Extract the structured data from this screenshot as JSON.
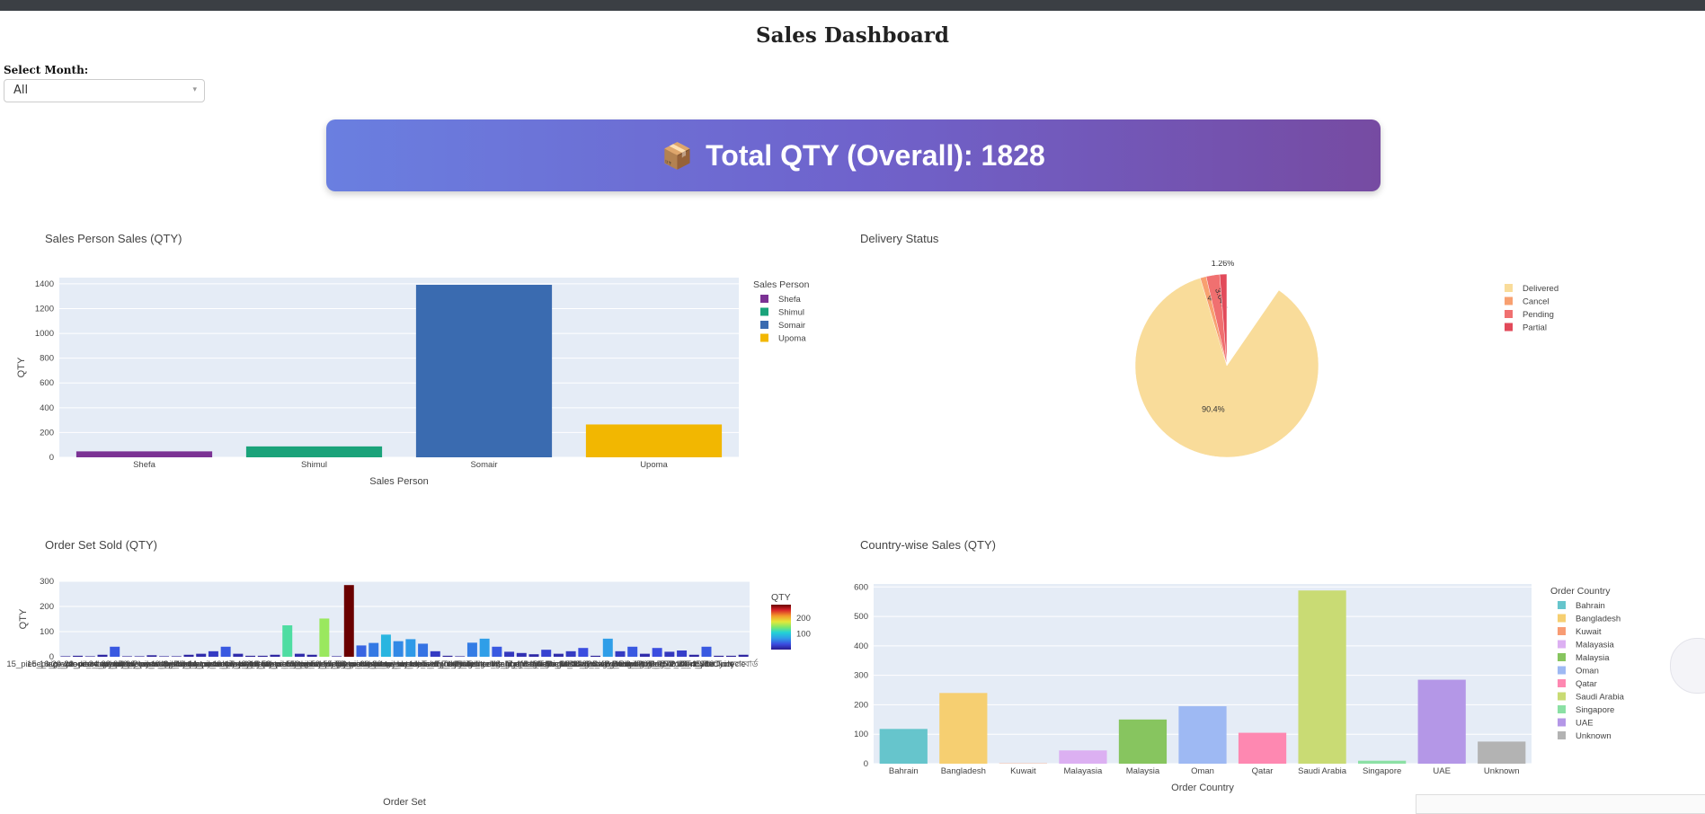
{
  "page": {
    "title": "Sales Dashboard"
  },
  "filter": {
    "label": "Select Month:",
    "selected": "All"
  },
  "kpi": {
    "icon": "package-icon",
    "text": "Total QTY (Overall): 1828"
  },
  "chart_data": [
    {
      "id": "sales_person",
      "type": "bar",
      "title": "Sales Person Sales (QTY)",
      "xlabel": "Sales Person",
      "ylabel": "QTY",
      "legend_title": "Sales Person",
      "legend_position": "right",
      "ylim": [
        0,
        1450
      ],
      "yticks": [
        0,
        200,
        400,
        600,
        800,
        1000,
        1200,
        1400
      ],
      "grid": true,
      "categories": [
        "Shefa",
        "Shimul",
        "Somair",
        "Upoma"
      ],
      "values": [
        48,
        88,
        1392,
        265
      ],
      "colors": [
        "#7b3294",
        "#1aa37a",
        "#3a6bb0",
        "#f2b701"
      ]
    },
    {
      "id": "delivery",
      "type": "pie",
      "title": "Delivery Status",
      "legend_position": "right",
      "labels": [
        "Delivered",
        "Cancel",
        "Pending",
        "Partial"
      ],
      "values": [
        90.4,
        4.7,
        3.64,
        1.26
      ],
      "slice_labels": [
        "90.4%",
        "4.7%",
        "3.64%",
        "1.26%"
      ],
      "colors": [
        "#f9dc9a",
        "#f8a070",
        "#f07070",
        "#e24a5a"
      ]
    },
    {
      "id": "order_set",
      "type": "bar",
      "title": "Order Set Sold (QTY)",
      "xlabel": "Order Set",
      "ylabel": "QTY",
      "colorbar_title": "QTY",
      "colorbar_ticks": [
        100,
        200
      ],
      "ylim": [
        0,
        300
      ],
      "yticks": [
        0,
        100,
        200,
        300
      ],
      "grid": true,
      "categories": [
        "15_piece_big_wooden_toy_set",
        "15_piece_wooden_toy_set",
        "16_piece_wooden_toy_set",
        "20_piece_wooden_toy_set",
        "21_piece_wooden_toy_set",
        "22_piece_wooden_toy_set_other",
        "24_piece_wooden_toy_set",
        "32_piece_wooden_toy_set",
        "35_piece_wooden_toy_set",
        "36_piece_wooden_toy_set",
        "40_Pieces_Special_wooden_toy_Set",
        "40_piece_wooden_toy_set",
        "41_Pieces_wooden_toy_Set",
        "42_piece_wooden_toy_set",
        "44_piece_wooden_toy_set",
        "44_piece_wooden_toy_set_other",
        "46_piece_wooden_toy_set",
        "47_piece_wooden_toy_set",
        "48_piece_wooden_toy_set",
        "49_piece_wooden_toy_set",
        "50_piece_wooden_toy_set",
        "50_piece_wooden_toy_set_other",
        "51_piece_wooden_toy_set",
        "52_piece_big_wooden_toy_set",
        "52_piece_wooden_toy_set",
        "55_piece_wooden_toy_set",
        "58_piece_wooden_toy_set",
        "60_piece_new_wooden_toy_set",
        "60_piece_wooden_toy_set",
        "80_piece_wooden_toy_set",
        "HouseTent_TriCycle",
        "HouseTent_Tricycle",
        "House_Tent",
        "House_tent",
        "Intelligence_3_in_1",
        "Intelligence_7_in_1",
        "Intelligence_Book",
        "Intelligence_Tab",
        "Magnetic_Sticks_100",
        "Magnetic_Sticks_128",
        "Magnetic_Sticks_36",
        "Magnetic_Sticks_42",
        "Magnetic_Sticks_84",
        "Missing_item_sent",
        "Swimming_Pool_120",
        "Swimming_Pool_120_E",
        "Swimming_Pool_150",
        "Swimming_Pool_210",
        "Swimming_Pool_34x10",
        "Swimming_Pool_45x10",
        "TentTent_Tricycle",
        "Tent_3ft",
        "Tent_Medium",
        "TriCycle",
        "Tricycle",
        "কলবোর্ড"
      ],
      "values": [
        2,
        4,
        2,
        8,
        40,
        2,
        2,
        6,
        2,
        2,
        8,
        12,
        22,
        40,
        12,
        4,
        4,
        8,
        125,
        12,
        8,
        152,
        2,
        285,
        45,
        55,
        88,
        62,
        70,
        52,
        22,
        4,
        2,
        56,
        72,
        40,
        20,
        15,
        10,
        28,
        12,
        22,
        35,
        4,
        72,
        22,
        40,
        12,
        35,
        20,
        25,
        8,
        40,
        4,
        4,
        8
      ]
    },
    {
      "id": "country",
      "type": "bar",
      "title": "Country-wise Sales (QTY)",
      "xlabel": "Order Country",
      "ylabel": "QTY",
      "legend_title": "Order Country",
      "legend_position": "right",
      "ylim": [
        0,
        610
      ],
      "yticks": [
        0,
        100,
        200,
        300,
        400,
        500,
        600
      ],
      "grid": true,
      "categories": [
        "Bahrain",
        "Bangladesh",
        "Kuwait",
        "Malayasia",
        "Malaysia",
        "Oman",
        "Qatar",
        "Saudi Arabia",
        "Singapore",
        "UAE",
        "Unknown"
      ],
      "values": [
        118,
        240,
        1,
        45,
        150,
        195,
        105,
        588,
        10,
        285,
        75
      ],
      "colors": [
        "#66c5cc",
        "#f6cf71",
        "#f89c74",
        "#dcb0f2",
        "#87c55f",
        "#9eb9f3",
        "#fe88b1",
        "#c9db74",
        "#8be0a4",
        "#b497e7",
        "#b3b3b3"
      ]
    }
  ]
}
